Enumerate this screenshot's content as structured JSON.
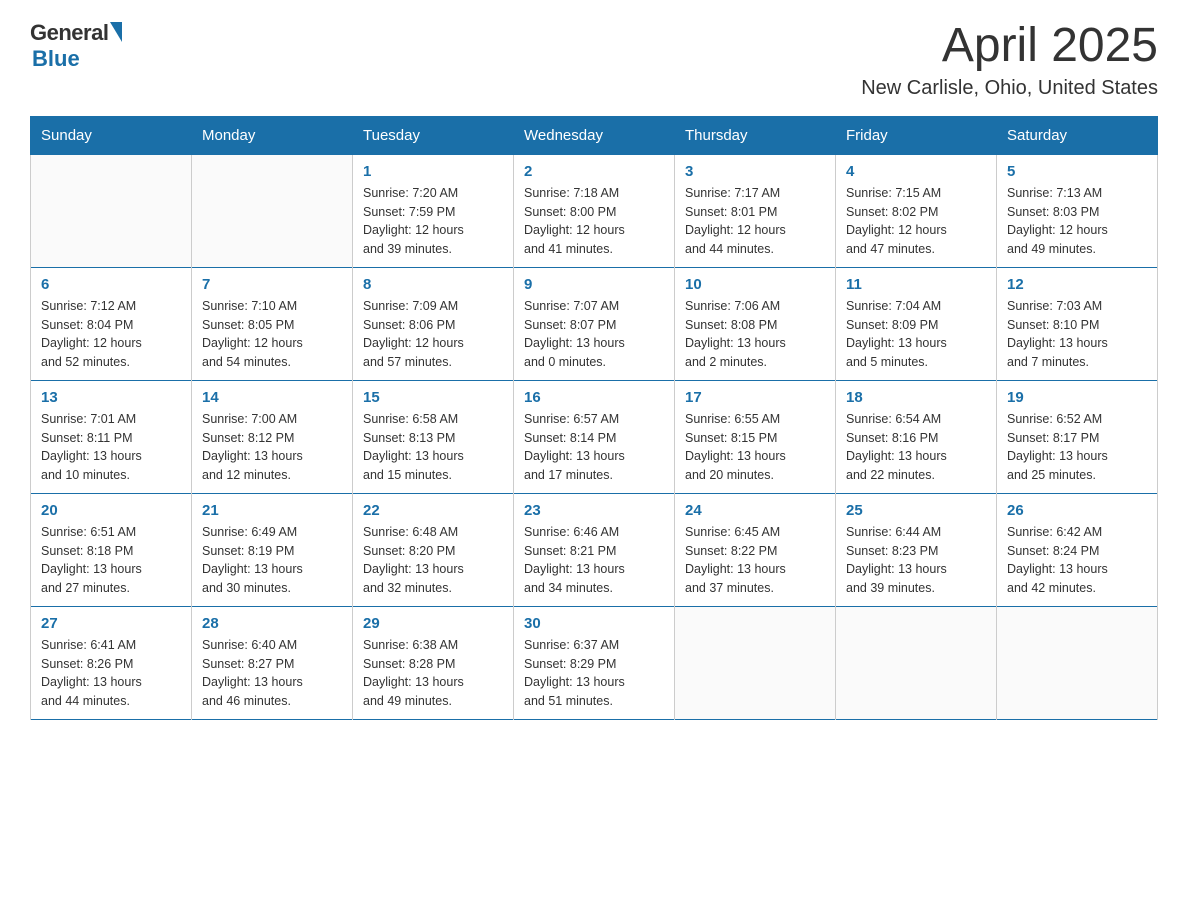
{
  "logo": {
    "general": "General",
    "blue": "Blue"
  },
  "title": "April 2025",
  "location": "New Carlisle, Ohio, United States",
  "days_of_week": [
    "Sunday",
    "Monday",
    "Tuesday",
    "Wednesday",
    "Thursday",
    "Friday",
    "Saturday"
  ],
  "weeks": [
    [
      {
        "num": "",
        "info": ""
      },
      {
        "num": "",
        "info": ""
      },
      {
        "num": "1",
        "info": "Sunrise: 7:20 AM\nSunset: 7:59 PM\nDaylight: 12 hours\nand 39 minutes."
      },
      {
        "num": "2",
        "info": "Sunrise: 7:18 AM\nSunset: 8:00 PM\nDaylight: 12 hours\nand 41 minutes."
      },
      {
        "num": "3",
        "info": "Sunrise: 7:17 AM\nSunset: 8:01 PM\nDaylight: 12 hours\nand 44 minutes."
      },
      {
        "num": "4",
        "info": "Sunrise: 7:15 AM\nSunset: 8:02 PM\nDaylight: 12 hours\nand 47 minutes."
      },
      {
        "num": "5",
        "info": "Sunrise: 7:13 AM\nSunset: 8:03 PM\nDaylight: 12 hours\nand 49 minutes."
      }
    ],
    [
      {
        "num": "6",
        "info": "Sunrise: 7:12 AM\nSunset: 8:04 PM\nDaylight: 12 hours\nand 52 minutes."
      },
      {
        "num": "7",
        "info": "Sunrise: 7:10 AM\nSunset: 8:05 PM\nDaylight: 12 hours\nand 54 minutes."
      },
      {
        "num": "8",
        "info": "Sunrise: 7:09 AM\nSunset: 8:06 PM\nDaylight: 12 hours\nand 57 minutes."
      },
      {
        "num": "9",
        "info": "Sunrise: 7:07 AM\nSunset: 8:07 PM\nDaylight: 13 hours\nand 0 minutes."
      },
      {
        "num": "10",
        "info": "Sunrise: 7:06 AM\nSunset: 8:08 PM\nDaylight: 13 hours\nand 2 minutes."
      },
      {
        "num": "11",
        "info": "Sunrise: 7:04 AM\nSunset: 8:09 PM\nDaylight: 13 hours\nand 5 minutes."
      },
      {
        "num": "12",
        "info": "Sunrise: 7:03 AM\nSunset: 8:10 PM\nDaylight: 13 hours\nand 7 minutes."
      }
    ],
    [
      {
        "num": "13",
        "info": "Sunrise: 7:01 AM\nSunset: 8:11 PM\nDaylight: 13 hours\nand 10 minutes."
      },
      {
        "num": "14",
        "info": "Sunrise: 7:00 AM\nSunset: 8:12 PM\nDaylight: 13 hours\nand 12 minutes."
      },
      {
        "num": "15",
        "info": "Sunrise: 6:58 AM\nSunset: 8:13 PM\nDaylight: 13 hours\nand 15 minutes."
      },
      {
        "num": "16",
        "info": "Sunrise: 6:57 AM\nSunset: 8:14 PM\nDaylight: 13 hours\nand 17 minutes."
      },
      {
        "num": "17",
        "info": "Sunrise: 6:55 AM\nSunset: 8:15 PM\nDaylight: 13 hours\nand 20 minutes."
      },
      {
        "num": "18",
        "info": "Sunrise: 6:54 AM\nSunset: 8:16 PM\nDaylight: 13 hours\nand 22 minutes."
      },
      {
        "num": "19",
        "info": "Sunrise: 6:52 AM\nSunset: 8:17 PM\nDaylight: 13 hours\nand 25 minutes."
      }
    ],
    [
      {
        "num": "20",
        "info": "Sunrise: 6:51 AM\nSunset: 8:18 PM\nDaylight: 13 hours\nand 27 minutes."
      },
      {
        "num": "21",
        "info": "Sunrise: 6:49 AM\nSunset: 8:19 PM\nDaylight: 13 hours\nand 30 minutes."
      },
      {
        "num": "22",
        "info": "Sunrise: 6:48 AM\nSunset: 8:20 PM\nDaylight: 13 hours\nand 32 minutes."
      },
      {
        "num": "23",
        "info": "Sunrise: 6:46 AM\nSunset: 8:21 PM\nDaylight: 13 hours\nand 34 minutes."
      },
      {
        "num": "24",
        "info": "Sunrise: 6:45 AM\nSunset: 8:22 PM\nDaylight: 13 hours\nand 37 minutes."
      },
      {
        "num": "25",
        "info": "Sunrise: 6:44 AM\nSunset: 8:23 PM\nDaylight: 13 hours\nand 39 minutes."
      },
      {
        "num": "26",
        "info": "Sunrise: 6:42 AM\nSunset: 8:24 PM\nDaylight: 13 hours\nand 42 minutes."
      }
    ],
    [
      {
        "num": "27",
        "info": "Sunrise: 6:41 AM\nSunset: 8:26 PM\nDaylight: 13 hours\nand 44 minutes."
      },
      {
        "num": "28",
        "info": "Sunrise: 6:40 AM\nSunset: 8:27 PM\nDaylight: 13 hours\nand 46 minutes."
      },
      {
        "num": "29",
        "info": "Sunrise: 6:38 AM\nSunset: 8:28 PM\nDaylight: 13 hours\nand 49 minutes."
      },
      {
        "num": "30",
        "info": "Sunrise: 6:37 AM\nSunset: 8:29 PM\nDaylight: 13 hours\nand 51 minutes."
      },
      {
        "num": "",
        "info": ""
      },
      {
        "num": "",
        "info": ""
      },
      {
        "num": "",
        "info": ""
      }
    ]
  ]
}
